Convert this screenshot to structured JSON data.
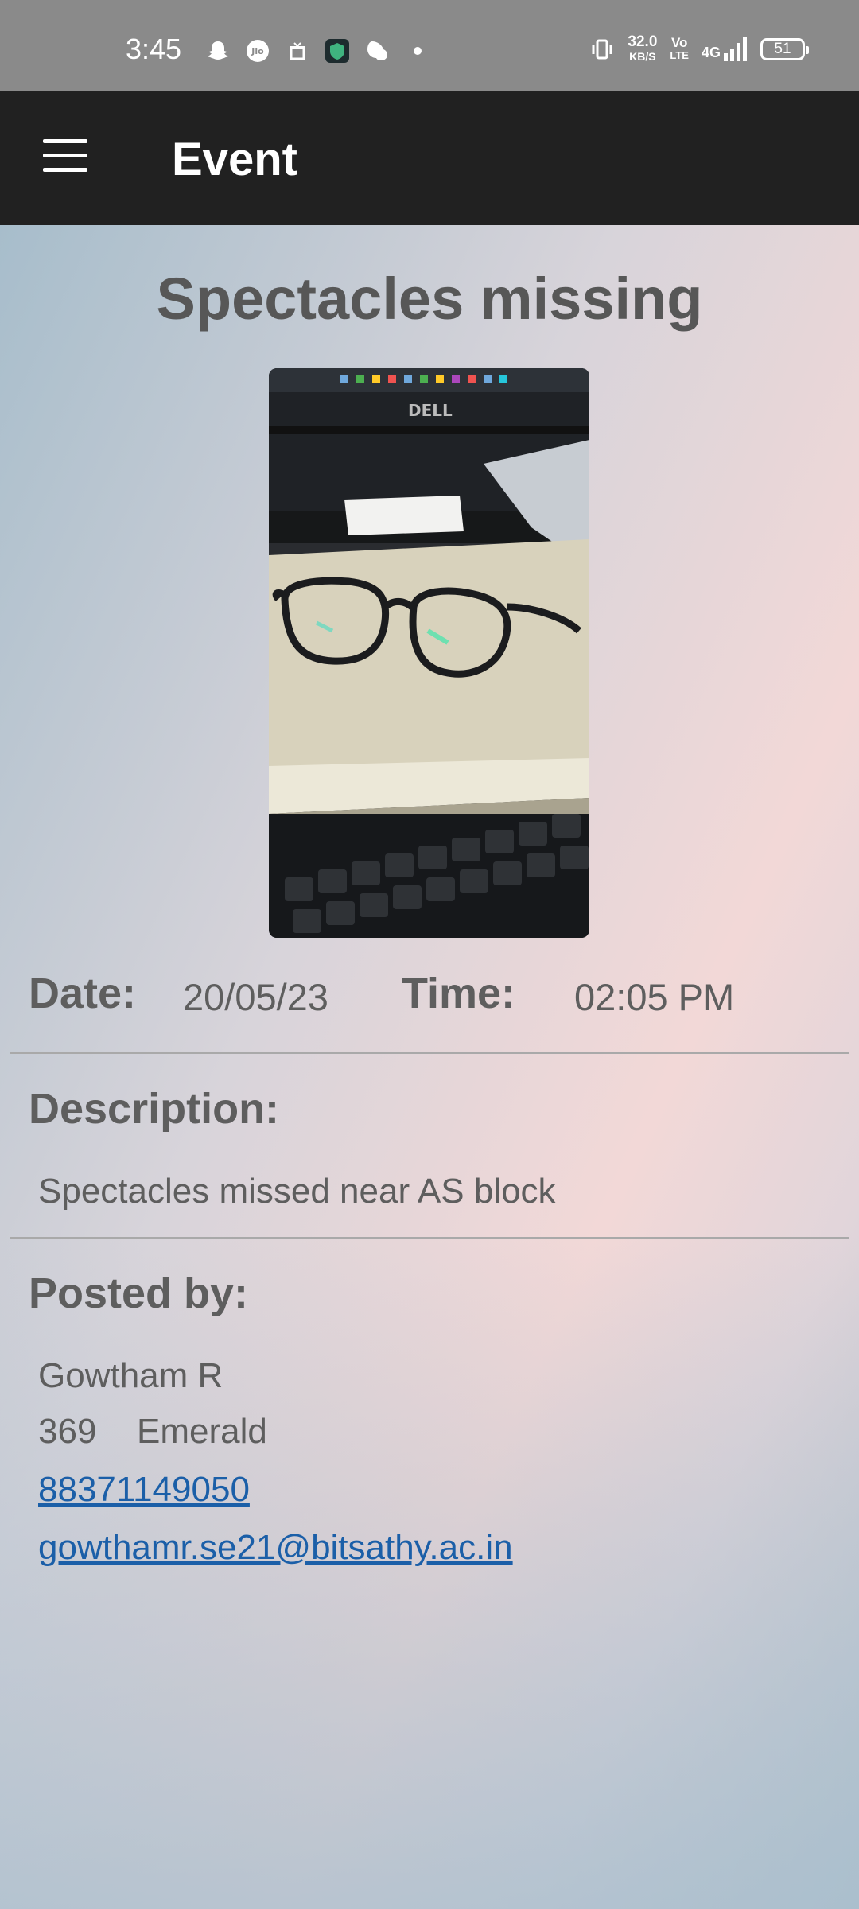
{
  "status_bar": {
    "time": "3:45",
    "left_icons": [
      "snapchat-icon",
      "jio-icon",
      "gift-icon",
      "shield-app-icon",
      "chat-icon",
      "dot-icon"
    ],
    "speed_value": "32.0",
    "speed_unit": "KB/S",
    "volte_top": "Vo",
    "volte_bottom": "LTE",
    "network": "4G",
    "battery": "51"
  },
  "app_bar": {
    "menu_icon": "hamburger-menu-icon",
    "title": "Event"
  },
  "event": {
    "title": "Spectacles missing",
    "photo_icon": "spectacles-photo",
    "date_label": "Date:",
    "date_value": "20/05/23",
    "time_label": "Time:",
    "time_value": "02:05 PM",
    "description_label": "Description:",
    "description_text": "Spectacles missed near AS block",
    "posted_by_label": "Posted by:",
    "poster_name": "Gowtham R",
    "poster_room": "369",
    "poster_block": "Emerald",
    "poster_phone": "88371149050",
    "poster_email": "gowthamr.se21@bitsathy.ac.in"
  },
  "colors": {
    "app_bar": "#212121",
    "status_bar": "#8a8a8a",
    "link": "#1b5fa8",
    "text": "#5e5e5e"
  }
}
